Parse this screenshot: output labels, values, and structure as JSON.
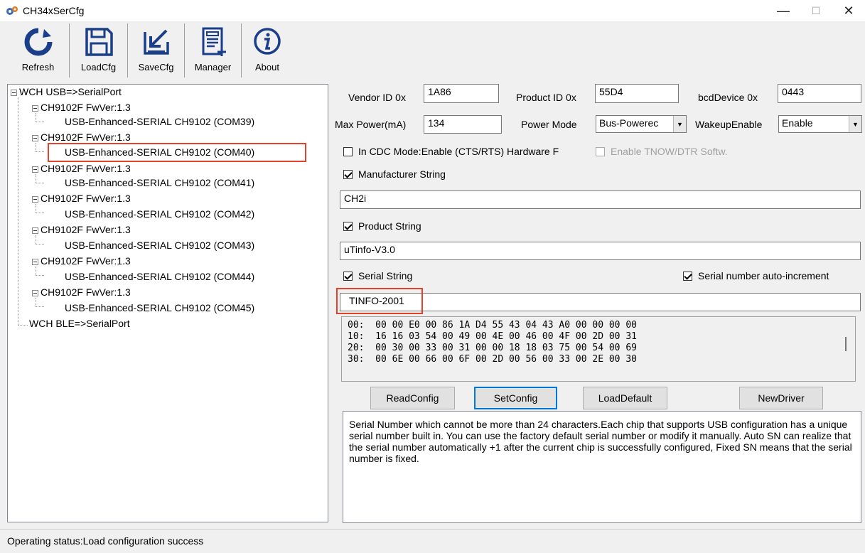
{
  "window": {
    "title": "CH34xSerCfg"
  },
  "toolbar": {
    "buttons": [
      {
        "label": "Refresh",
        "icon": "refresh-icon"
      },
      {
        "label": "LoadCfg",
        "icon": "floppy-icon"
      },
      {
        "label": "SaveCfg",
        "icon": "save-download-icon"
      },
      {
        "label": "Manager",
        "icon": "manager-list-icon"
      },
      {
        "label": "About",
        "icon": "info-icon"
      }
    ]
  },
  "tree": {
    "root_usb": "WCH USB=>SerialPort",
    "devices": [
      {
        "name": "CH9102F FwVer:1.3",
        "port": "USB-Enhanced-SERIAL CH9102 (COM39)"
      },
      {
        "name": "CH9102F FwVer:1.3",
        "port": "USB-Enhanced-SERIAL CH9102 (COM40)"
      },
      {
        "name": "CH9102F FwVer:1.3",
        "port": "USB-Enhanced-SERIAL CH9102 (COM41)"
      },
      {
        "name": "CH9102F FwVer:1.3",
        "port": "USB-Enhanced-SERIAL CH9102 (COM42)"
      },
      {
        "name": "CH9102F FwVer:1.3",
        "port": "USB-Enhanced-SERIAL CH9102 (COM43)"
      },
      {
        "name": "CH9102F FwVer:1.3",
        "port": "USB-Enhanced-SERIAL CH9102 (COM44)"
      },
      {
        "name": "CH9102F FwVer:1.3",
        "port": "USB-Enhanced-SERIAL CH9102 (COM45)"
      }
    ],
    "root_ble": "WCH BLE=>SerialPort",
    "selected_index": 1
  },
  "config": {
    "vendor_id_label": "Vendor ID 0x",
    "vendor_id": "1A86",
    "product_id_label": "Product ID 0x",
    "product_id": "55D4",
    "bcd_device_label": "bcdDevice 0x",
    "bcd_device": "0443",
    "max_power_label": "Max Power(mA)",
    "max_power": "134",
    "power_mode_label": "Power Mode",
    "power_mode": "Bus-Powerec",
    "wakeup_label": "WakeupEnable",
    "wakeup": "Enable",
    "cdc_mode_label": "In CDC Mode:Enable (CTS/RTS) Hardware F",
    "tnow_label": "Enable TNOW/DTR Softw.",
    "manufacturer_label": "Manufacturer String",
    "manufacturer_value": "CH2i",
    "product_label": "Product String",
    "product_value": "uTinfo-V3.0",
    "serial_label": "Serial String",
    "serial_auto_label": "Serial number auto-increment",
    "serial_value": "TINFO-2001"
  },
  "hex_dump": [
    "00:  00 00 E0 00 86 1A D4 55 43 04 43 A0 00 00 00 00",
    "10:  16 16 03 54 00 49 00 4E 00 46 00 4F 00 2D 00 31",
    "20:  00 30 00 33 00 31 00 00 18 18 03 75 00 54 00 69",
    "30:  00 6E 00 66 00 6F 00 2D 00 56 00 33 00 2E 00 30"
  ],
  "actions": {
    "read": "ReadConfig",
    "set": "SetConfig",
    "load_default": "LoadDefault",
    "new_driver": "NewDriver"
  },
  "description": "Serial Number which cannot be more than 24 characters.Each chip that supports USB configuration has a unique serial number built in. You can use the factory default serial number or modify it manually. Auto SN can realize that the serial number automatically +1 after the current chip is successfully configured, Fixed SN means that the serial number is fixed.",
  "status": "Operating status:Load configuration success",
  "colors": {
    "highlight": "#e8402a",
    "focus": "#0078d7"
  }
}
